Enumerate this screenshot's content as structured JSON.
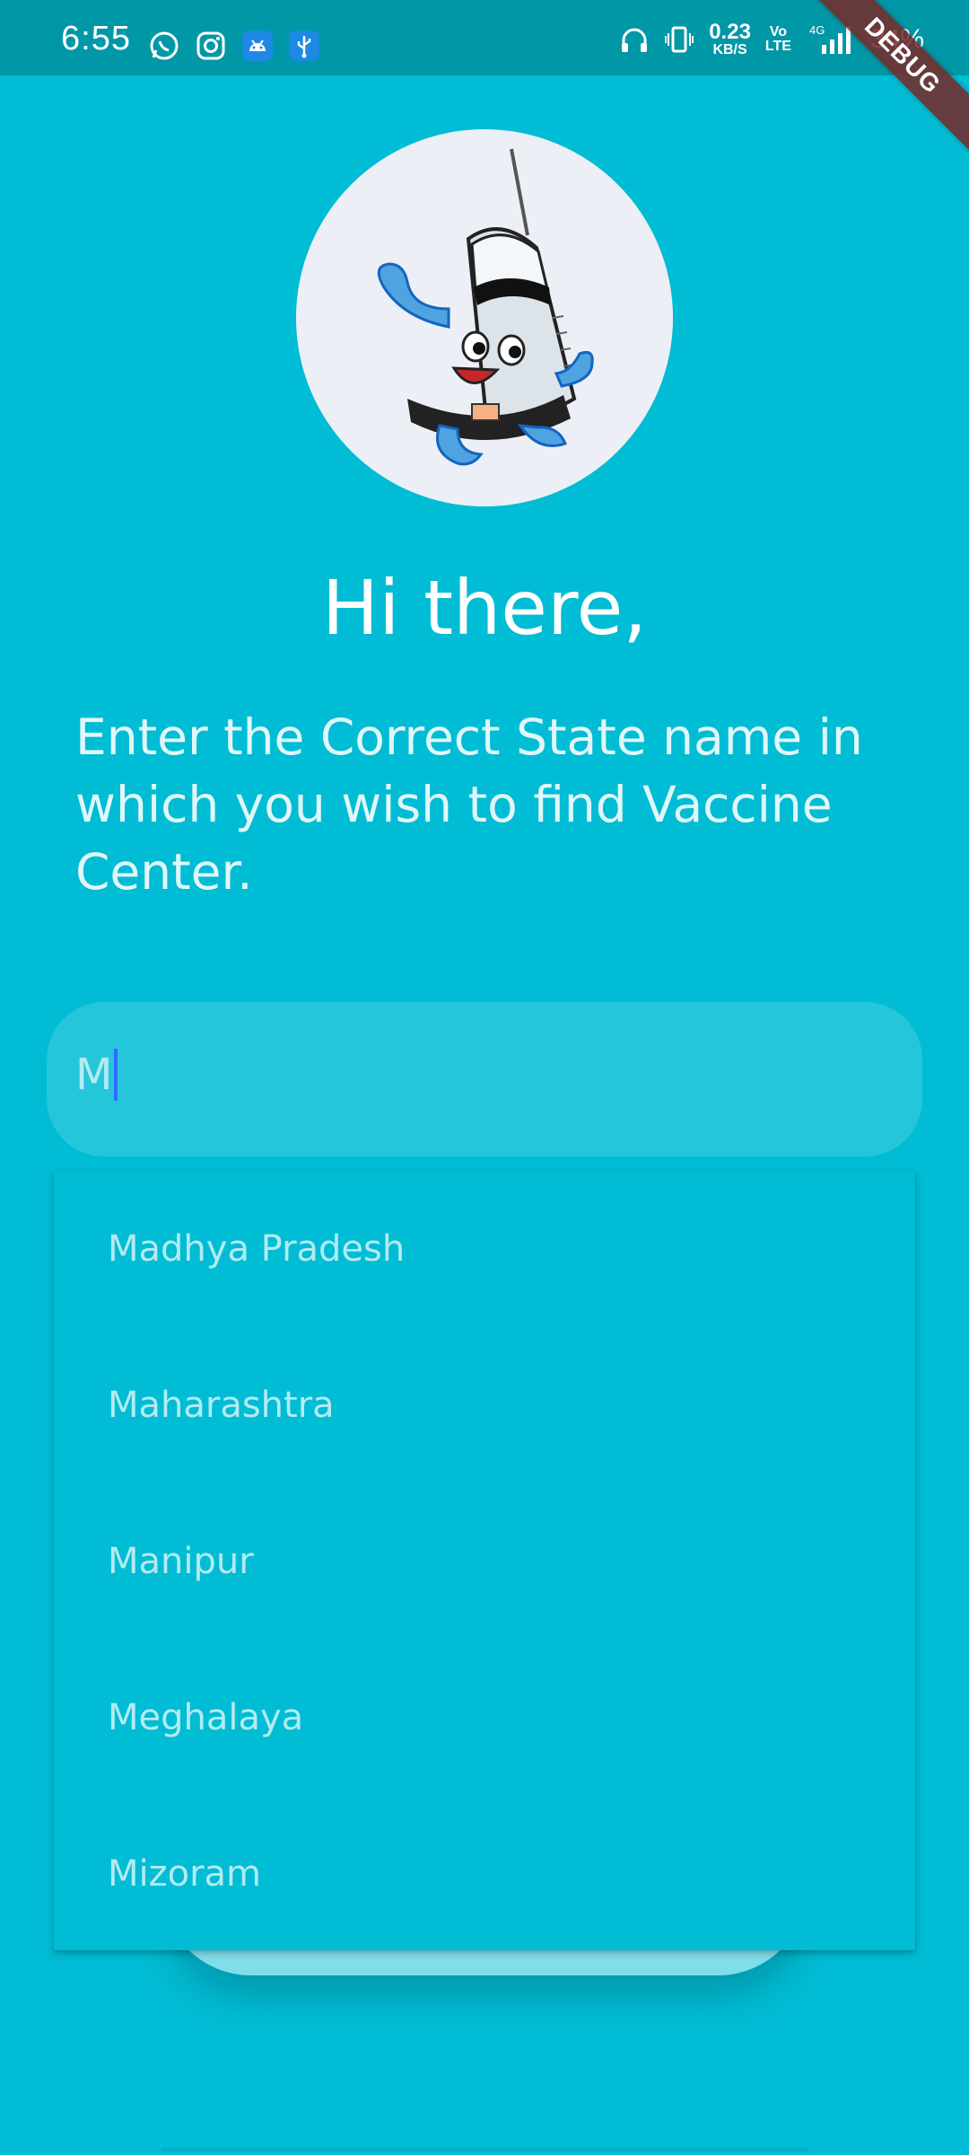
{
  "status_bar": {
    "time": "6:55",
    "net_speed_value": "0.23",
    "net_speed_unit": "KB/S",
    "volte_top": "Vo",
    "volte_bottom": "LTE",
    "network_type": "4G",
    "battery": "34%"
  },
  "debug_banner": "DEBUG",
  "header": {
    "greeting": "Hi there,",
    "instruction": "Enter the Correct State name in which you wish to find Vaccine Center."
  },
  "search": {
    "value": "M"
  },
  "suggestions": [
    "Madhya Pradesh",
    "Maharashtra",
    "Manipur",
    "Meghalaya",
    "Mizoram"
  ],
  "colors": {
    "background": "#00BCD4",
    "status_bar": "#0097A7",
    "input_fill": "#26C6DA",
    "caret": "#2F6BFF"
  }
}
